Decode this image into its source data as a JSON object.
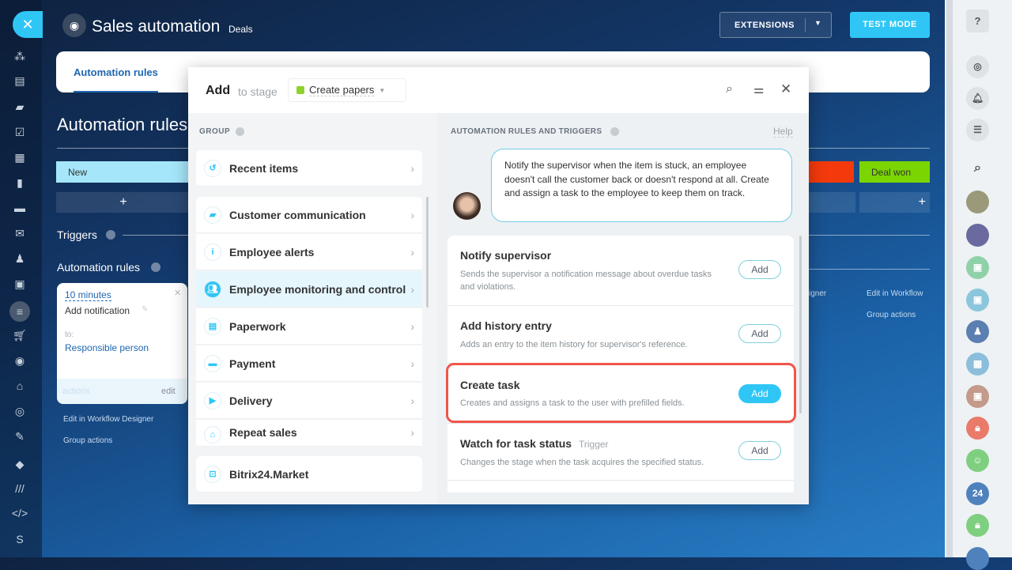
{
  "header": {
    "title": "Sales automation",
    "subtitle": "Deals",
    "extensions": "EXTENSIONS",
    "test_mode": "TEST MODE"
  },
  "tabs": [
    {
      "label": "Automation rules"
    }
  ],
  "page": {
    "title": "Automation rules",
    "stage_new": "New",
    "stage_won": "Deal won",
    "plus": "+",
    "triggers": "Triggers",
    "automation_rules": "Automation rules",
    "card": {
      "delay": "10 minutes",
      "name": "Add notification",
      "to_label": "to:",
      "to_value": "Responsible person",
      "actions": "actions",
      "edit": "edit"
    },
    "edit_designer": "Edit in Workflow Designer",
    "group_actions": "Group actions",
    "edit_designer_right": "Edit in Workflow",
    "designer_frag": "igner",
    "group_actions_right": "Group actions"
  },
  "modal": {
    "add": "Add",
    "to_stage": "to stage",
    "stage": "Create papers",
    "stage_color": "#8ed22c",
    "group_header": "GROUP",
    "rules_header": "AUTOMATION RULES AND TRIGGERS",
    "help": "Help",
    "groups": [
      {
        "label": "Recent items",
        "icon": "history-icon"
      },
      {
        "label": "Customer communication",
        "icon": "chat-icon"
      },
      {
        "label": "Employee alerts",
        "icon": "info-icon"
      },
      {
        "label": "Employee monitoring and control",
        "icon": "users-icon"
      },
      {
        "label": "Paperwork",
        "icon": "document-icon"
      },
      {
        "label": "Payment",
        "icon": "wallet-icon"
      },
      {
        "label": "Delivery",
        "icon": "truck-icon"
      },
      {
        "label": "Repeat sales",
        "icon": "register-icon"
      }
    ],
    "market": "Bitrix24.Market",
    "hint": "Notify the supervisor when the item is stuck, an employee doesn't call the customer back or doesn't respond at all. Create and assign a task to the employee to keep them on track.",
    "rules": [
      {
        "title": "Notify supervisor",
        "desc": "Sends the supervisor a notification message about overdue tasks and violations.",
        "button": "Add"
      },
      {
        "title": "Add history entry",
        "desc": "Adds an entry to the item history for supervisor's reference.",
        "button": "Add"
      },
      {
        "title": "Create task",
        "desc": "Creates and assigns a task to the user with prefilled fields.",
        "button": "Add"
      },
      {
        "title": "Watch for task status",
        "tag": "Trigger",
        "desc": "Changes the stage when the task acquires the specified status.",
        "button": "Add"
      }
    ]
  },
  "colors": {
    "accent": "#2fc6f6",
    "highlight": "#f0554b",
    "won": "#7bd500",
    "fail": "#f43a0c"
  },
  "rightbar": {
    "badge": "24"
  }
}
